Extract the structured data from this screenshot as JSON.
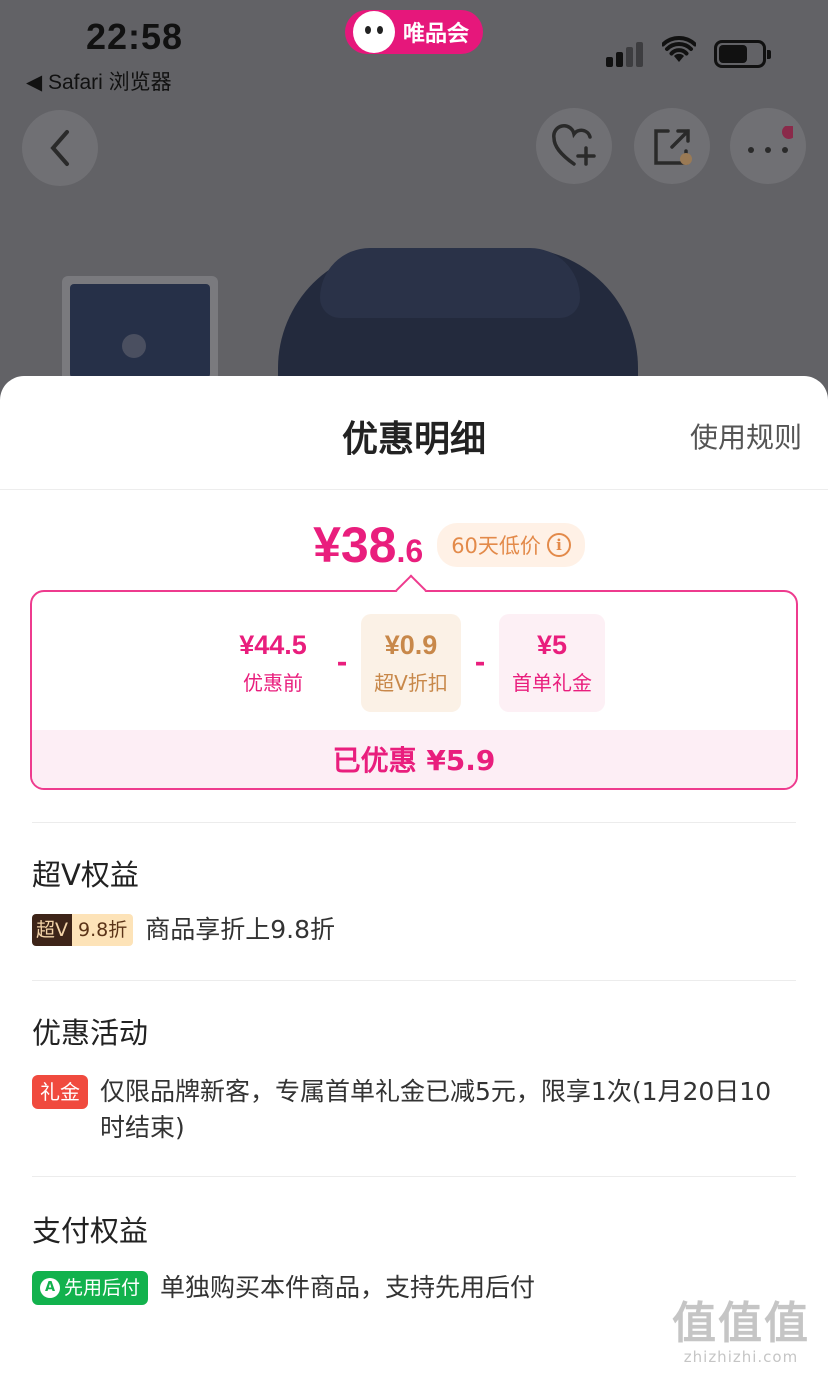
{
  "status_bar": {
    "time": "22:58",
    "back_app": "◀ Safari 浏览器",
    "app_badge": "唯品会"
  },
  "product_page": {
    "back_icon": "chevron-left-icon",
    "favorite_icon": "heart-plus-icon",
    "share_icon": "share-icon",
    "more_icon": "more-dots-icon"
  },
  "sheet": {
    "title": "优惠明细",
    "rules_link": "使用规则",
    "price_whole": "¥38",
    "price_decimal": ".6",
    "low_price_tag": "60天低价",
    "breakdown": {
      "before_amount": "¥44.5",
      "before_label": "优惠前",
      "minus": "-",
      "superv_amount": "¥0.9",
      "superv_label": "超V折扣",
      "gift_amount": "¥5",
      "gift_label": "首单礼金",
      "saved": "已优惠 ¥5.9"
    },
    "sections": {
      "superv": {
        "title": "超V权益",
        "tag_left": "超V",
        "tag_right": "9.8折",
        "text": "商品享折上9.8折"
      },
      "promo": {
        "title": "优惠活动",
        "tag": "礼金",
        "text": "仅限品牌新客，专属首单礼金已减5元，限享1次(1月20日10时结束)"
      },
      "payment": {
        "title": "支付权益",
        "tag": "先用后付",
        "text": "单独购买本件商品，支持先用后付"
      }
    }
  },
  "watermark": {
    "big": "值值值",
    "small": "zhizhizhi.com"
  },
  "colors": {
    "brand_pink": "#e91e7d",
    "gold": "#c8884a",
    "gift_red": "#f04a3e",
    "pay_green": "#12b24d"
  }
}
